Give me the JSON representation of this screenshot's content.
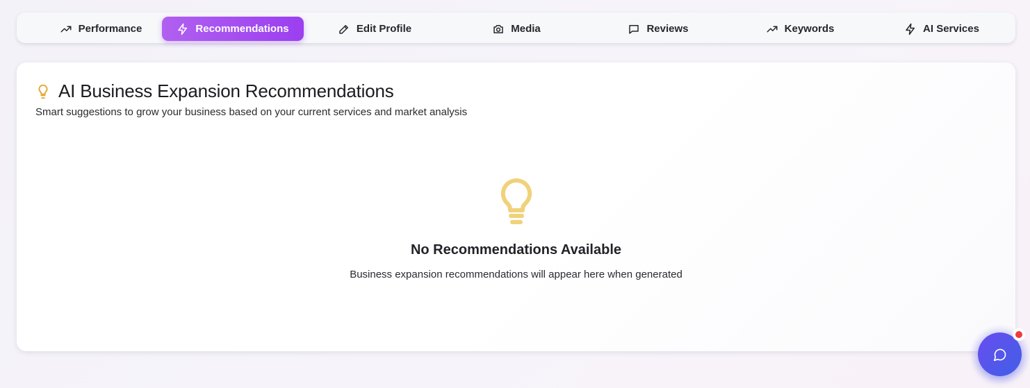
{
  "tabs": [
    {
      "label": "Performance",
      "icon": "trending-up-icon",
      "active": false
    },
    {
      "label": "Recommendations",
      "icon": "lightning-icon",
      "active": true
    },
    {
      "label": "Edit Profile",
      "icon": "pencil-icon",
      "active": false
    },
    {
      "label": "Media",
      "icon": "camera-icon",
      "active": false
    },
    {
      "label": "Reviews",
      "icon": "message-square-icon",
      "active": false
    },
    {
      "label": "Keywords",
      "icon": "trending-up-icon",
      "active": false
    },
    {
      "label": "AI Services",
      "icon": "lightning-icon",
      "active": false
    }
  ],
  "section": {
    "title": "AI Business Expansion Recommendations",
    "subtitle": "Smart suggestions to grow your business based on your current services and market analysis",
    "icon": "lightbulb-icon"
  },
  "empty_state": {
    "icon": "lightbulb-icon",
    "title": "No Recommendations Available",
    "text": "Business expansion recommendations will appear here when generated"
  },
  "chat": {
    "icon": "chat-bubble-icon",
    "has_notification": true
  },
  "colors": {
    "accent_start": "#b060f0",
    "accent_end": "#9b3ff0",
    "bulb_title": "#e0a82e",
    "bulb_empty": "#f0d27a",
    "chat": "#4f57ea",
    "notification": "#ef3b3b"
  }
}
